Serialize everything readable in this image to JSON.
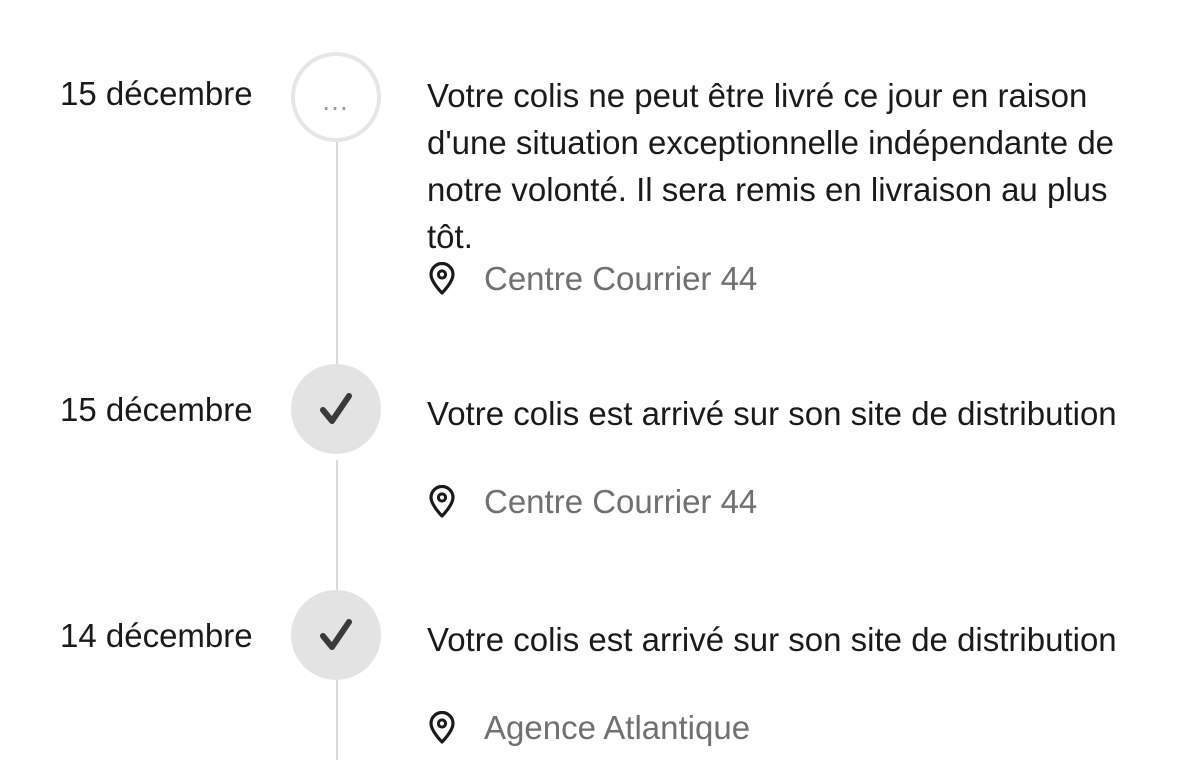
{
  "events": [
    {
      "date": "15 décembre",
      "status": "pending",
      "status_icon": "more-dots-icon",
      "status_glyph": "…",
      "description": "Votre colis ne peut être livré ce jour en raison d'une situation exceptionnelle indépendante de notre volonté. Il sera remis en livraison au plus tôt.",
      "location": "Centre Courrier 44"
    },
    {
      "date": "15 décembre",
      "status": "done",
      "status_icon": "checkmark-icon",
      "description": "Votre colis est arrivé sur son site de distribution",
      "location": "Centre Courrier 44"
    },
    {
      "date": "14 décembre",
      "status": "done",
      "status_icon": "checkmark-icon",
      "description": "Votre colis est arrivé sur son site de distribution",
      "location": "Agence Atlantique"
    }
  ],
  "colors": {
    "text": "#1a1a1a",
    "location_text": "#707070",
    "timeline_line": "#d9d9d9",
    "marker_done_bg": "#e3e3e3",
    "marker_pending_border": "#e6e6e6",
    "checkmark": "#3a3a3a"
  }
}
